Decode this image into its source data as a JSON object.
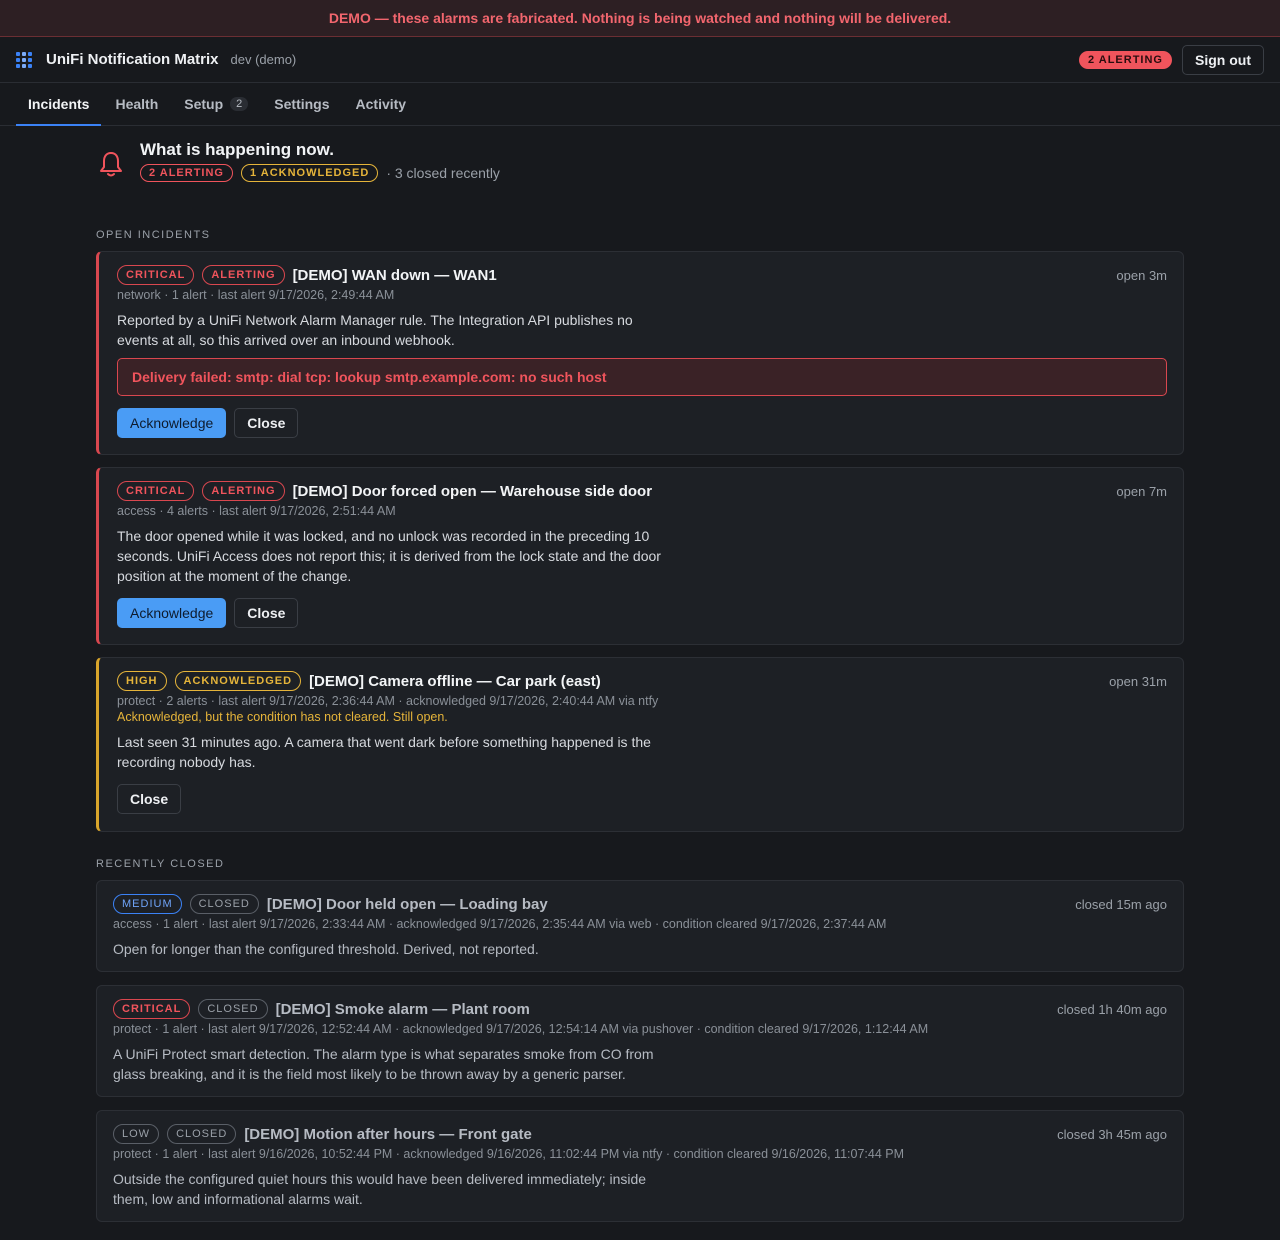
{
  "banner": "DEMO — these alarms are fabricated. Nothing is being watched and nothing will be delivered.",
  "app": {
    "title": "UniFi Notification Matrix",
    "env": "dev (demo)",
    "alert_pill": "2 ALERTING",
    "sign_out": "Sign out"
  },
  "tabs": [
    {
      "label": "Incidents",
      "active": true
    },
    {
      "label": "Health"
    },
    {
      "label": "Setup",
      "count": "2"
    },
    {
      "label": "Settings"
    },
    {
      "label": "Activity"
    }
  ],
  "summary": {
    "title": "What is happening now.",
    "alerting": "2 ALERTING",
    "acknowledged": "1 ACKNOWLEDGED",
    "closed_recently": "· 3 closed recently"
  },
  "open_label": "OPEN INCIDENTS",
  "closed_label": "RECENTLY CLOSED",
  "open": [
    {
      "severity": "CRITICAL",
      "state": "ALERTING",
      "title": "[DEMO] WAN down — WAN1",
      "time": "open 3m",
      "meta": "network · 1 alert · last alert 9/17/2026, 2:49:44 AM",
      "desc": "Reported by a UniFi Network Alarm Manager rule. The Integration API publishes no events at all, so this arrived over an inbound webhook.",
      "failure": "Delivery failed: smtp: dial tcp: lookup smtp.example.com: no such host",
      "ack": "Acknowledge",
      "close": "Close"
    },
    {
      "severity": "CRITICAL",
      "state": "ALERTING",
      "title": "[DEMO] Door forced open — Warehouse side door",
      "time": "open 7m",
      "meta": "access · 4 alerts · last alert 9/17/2026, 2:51:44 AM",
      "desc": "The door opened while it was locked, and no unlock was recorded in the preceding 10 seconds. UniFi Access does not report this; it is derived from the lock state and the door position at the moment of the change.",
      "ack": "Acknowledge",
      "close": "Close"
    },
    {
      "severity": "HIGH",
      "state": "ACKNOWLEDGED",
      "title": "[DEMO] Camera offline — Car park (east)",
      "time": "open 31m",
      "meta": "protect · 2 alerts · last alert 9/17/2026, 2:36:44 AM · acknowledged 9/17/2026, 2:40:44 AM via ntfy",
      "note": "Acknowledged, but the condition has not cleared. Still open.",
      "desc": "Last seen 31 minutes ago. A camera that went dark before something happened is the recording nobody has.",
      "close": "Close"
    }
  ],
  "closed": [
    {
      "severity": "MEDIUM",
      "state": "CLOSED",
      "title": "[DEMO] Door held open — Loading bay",
      "time": "closed 15m ago",
      "meta": "access · 1 alert · last alert 9/17/2026, 2:33:44 AM · acknowledged 9/17/2026, 2:35:44 AM via web · condition cleared 9/17/2026, 2:37:44 AM",
      "desc": "Open for longer than the configured threshold. Derived, not reported."
    },
    {
      "severity": "CRITICAL",
      "state": "CLOSED",
      "title": "[DEMO] Smoke alarm — Plant room",
      "time": "closed 1h 40m ago",
      "meta": "protect · 1 alert · last alert 9/17/2026, 12:52:44 AM · acknowledged 9/17/2026, 12:54:14 AM via pushover · condition cleared 9/17/2026, 1:12:44 AM",
      "desc": "A UniFi Protect smart detection. The alarm type is what separates smoke from CO from glass breaking, and it is the field most likely to be thrown away by a generic parser."
    },
    {
      "severity": "LOW",
      "state": "CLOSED",
      "title": "[DEMO] Motion after hours — Front gate",
      "time": "closed 3h 45m ago",
      "meta": "protect · 1 alert · last alert 9/16/2026, 10:52:44 PM · acknowledged 9/16/2026, 11:02:44 PM via ntfy · condition cleared 9/16/2026, 11:07:44 PM",
      "desc": "Outside the configured quiet hours this would have been delivered immediately; inside them, low and informational alarms wait."
    }
  ]
}
